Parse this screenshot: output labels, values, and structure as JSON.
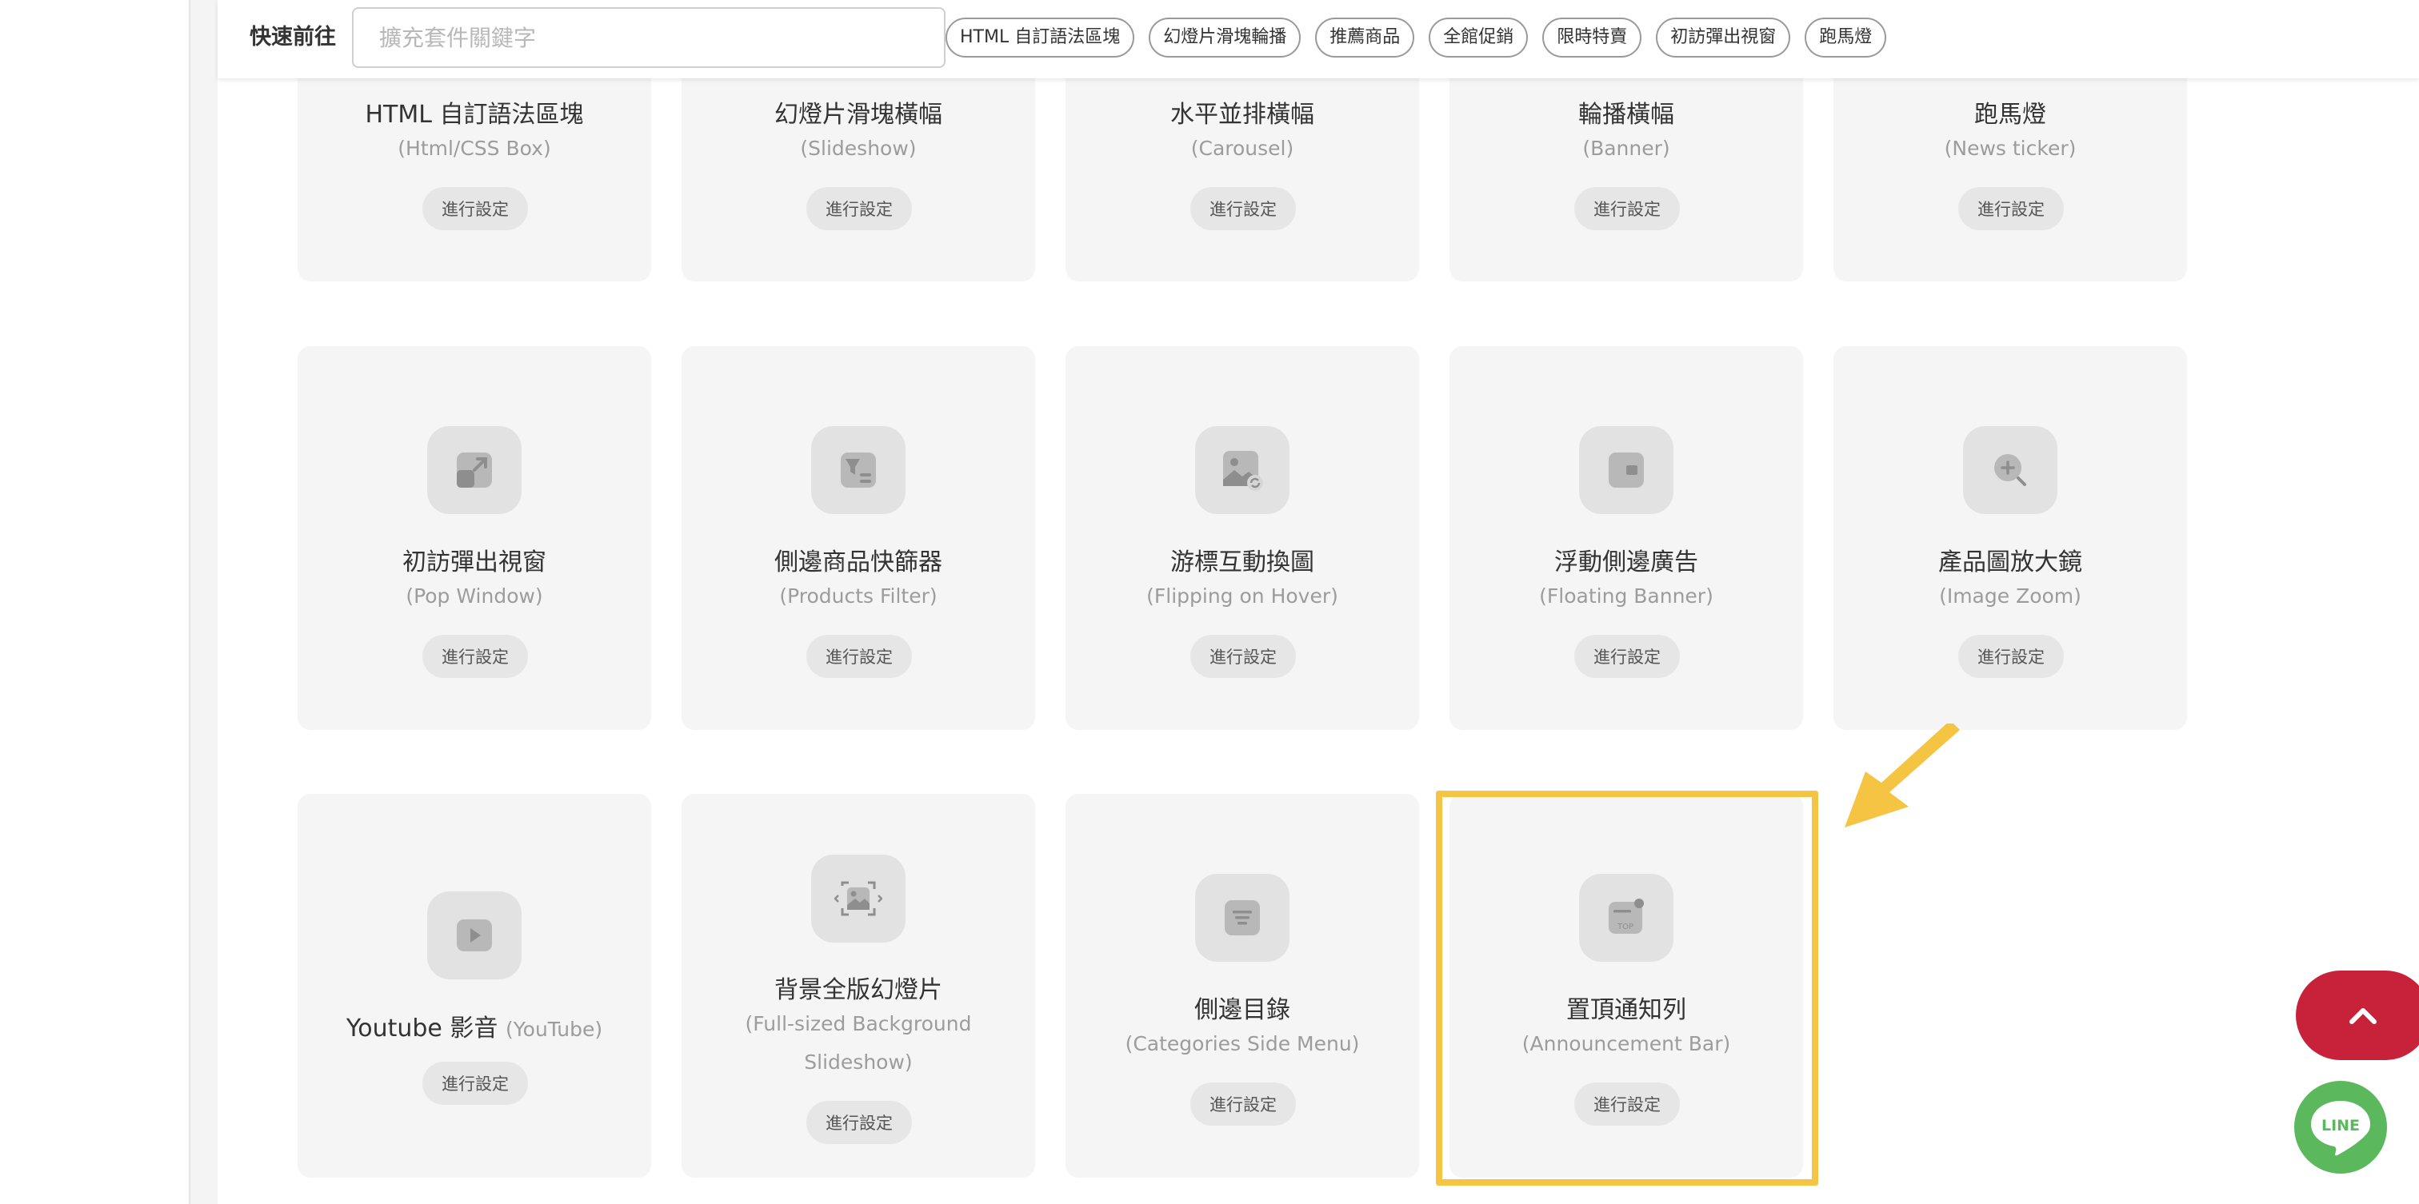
{
  "quick_nav": {
    "label": "快速前往",
    "search_placeholder": "擴充套件關鍵字",
    "chips": [
      "HTML 自訂語法區塊",
      "幻燈片滑塊輪播",
      "推薦商品",
      "全館促銷",
      "限時特賣",
      "初訪彈出視窗",
      "跑馬燈"
    ]
  },
  "cards": [
    {
      "title": "HTML 自訂語法區塊",
      "subtitle": "(Html/CSS Box)",
      "button": "進行設定"
    },
    {
      "title": "幻燈片滑塊橫幅",
      "subtitle": "(Slideshow)",
      "button": "進行設定"
    },
    {
      "title": "水平並排橫幅",
      "subtitle": "(Carousel)",
      "button": "進行設定"
    },
    {
      "title": "輪播橫幅",
      "subtitle": "(Banner)",
      "button": "進行設定"
    },
    {
      "title": "跑馬燈",
      "subtitle": "(News ticker)",
      "button": "進行設定"
    },
    {
      "title": "初訪彈出視窗",
      "subtitle": "(Pop Window)",
      "button": "進行設定",
      "icon": "popup-window-icon"
    },
    {
      "title": "側邊商品快篩器",
      "subtitle": "(Products Filter)",
      "button": "進行設定",
      "icon": "filter-icon"
    },
    {
      "title": "游標互動換圖",
      "subtitle": "(Flipping on Hover)",
      "button": "進行設定",
      "icon": "image-swap-icon"
    },
    {
      "title": "浮動側邊廣告",
      "subtitle": "(Floating Banner)",
      "button": "進行設定",
      "icon": "floating-banner-icon"
    },
    {
      "title": "產品圖放大鏡",
      "subtitle": "(Image Zoom)",
      "button": "進行設定",
      "icon": "zoom-icon"
    },
    {
      "title": "Youtube 影音",
      "subtitle": "(YouTube)",
      "button": "進行設定",
      "icon": "play-icon"
    },
    {
      "title": "背景全版幻燈片",
      "subtitle": "(Full-sized Background Slideshow)",
      "button": "進行設定",
      "icon": "fullscreen-slideshow-icon"
    },
    {
      "title": "側邊目錄",
      "subtitle": "(Categories Side Menu)",
      "button": "進行設定",
      "icon": "menu-list-icon"
    },
    {
      "title": "置頂通知列",
      "subtitle": "(Announcement Bar)",
      "button": "進行設定",
      "icon": "announcement-top-icon",
      "icon_text": "TOP"
    }
  ],
  "highlight_color": "#f5c443",
  "back_to_top_color": "#c8213a",
  "line": {
    "label": "LINE",
    "color": "#5cb85c"
  }
}
